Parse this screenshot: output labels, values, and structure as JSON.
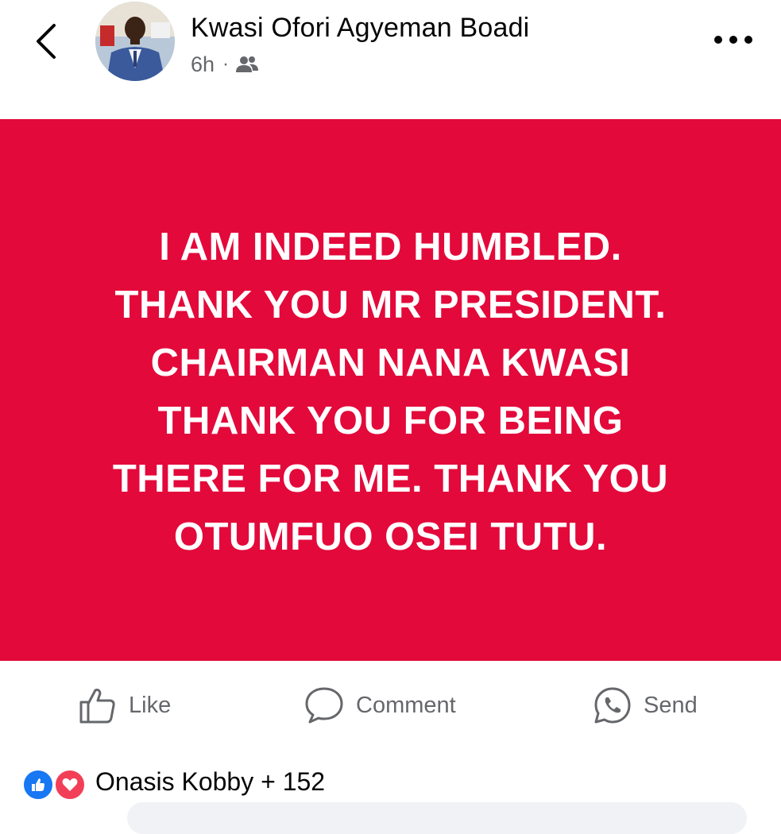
{
  "post": {
    "author_name": "Kwasi Ofori Agyeman Boadi",
    "time_ago": "6h",
    "separator": "·",
    "audience_icon": "friends-icon",
    "background_color": "#e3093b",
    "text_lines": [
      "I AM INDEED HUMBLED.",
      "THANK YOU MR PRESIDENT.",
      "CHAIRMAN NANA KWASI",
      "THANK YOU FOR BEING",
      "THERE FOR ME. THANK YOU",
      "OTUMFUO OSEI TUTU."
    ]
  },
  "actions": {
    "like_label": "Like",
    "comment_label": "Comment",
    "send_label": "Send"
  },
  "reactions": {
    "summary": "Onasis Kobby + 152",
    "like_color": "#1877f2",
    "love_color": "#f33e58"
  },
  "colors": {
    "secondary_text": "#65676b",
    "primary_text": "#050505"
  }
}
